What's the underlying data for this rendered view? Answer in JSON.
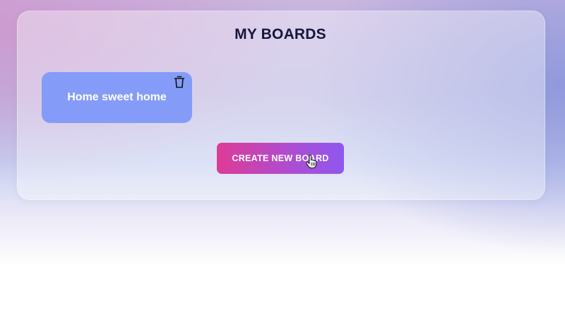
{
  "page": {
    "title": "MY BOARDS"
  },
  "boards": [
    {
      "name": "Home sweet home"
    }
  ],
  "actions": {
    "create_label": "CREATE NEW BOARD"
  },
  "colors": {
    "board_card": "#849cf8",
    "title_text": "#17153b",
    "button_gradient_start": "#de3b95",
    "button_gradient_end": "#8e58f0"
  },
  "icons": {
    "delete": "trash-icon",
    "pointer": "hand-cursor-icon"
  }
}
